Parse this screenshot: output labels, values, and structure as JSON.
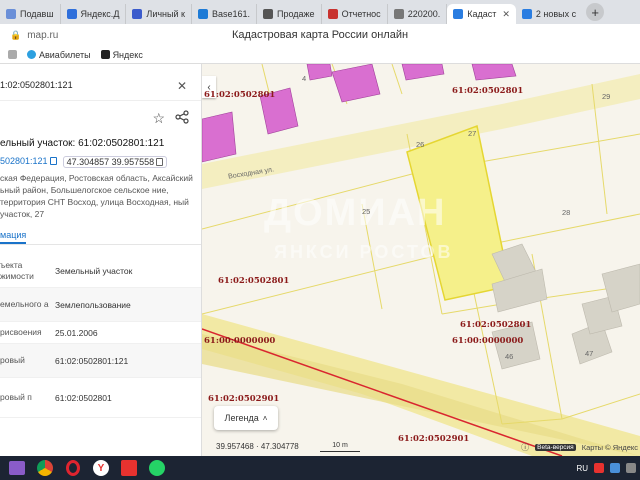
{
  "browser": {
    "tabs": [
      {
        "label": "Подавш",
        "color": "#6a8fd8"
      },
      {
        "label": "Яндекс.Д",
        "color": "#2f6fdb"
      },
      {
        "label": "Личный к",
        "color": "#3b5bcc"
      },
      {
        "label": "Base161.",
        "color": "#1e7bd6"
      },
      {
        "label": "Продаже",
        "color": "#555"
      },
      {
        "label": "Отчетнос",
        "color": "#c8322f"
      },
      {
        "label": "220200.",
        "color": "#777"
      },
      {
        "label": "Кадаст",
        "color": "#2a7de1",
        "active": true
      },
      {
        "label": "2 новых с",
        "color": "#2a7de1"
      }
    ],
    "new_tab": "+",
    "url": "map.ru",
    "page_title": "Кадастровая карта России онлайн",
    "bookmarks": [
      {
        "label": "",
        "color": "#aaa"
      },
      {
        "label": "Авиабилеты",
        "color": "#2da0e0"
      },
      {
        "label": "Яндекс",
        "color": "#222"
      }
    ]
  },
  "panel": {
    "header_number": "1:02:0502801:121",
    "parcel_title": "ельный участок: 61:02:0502801:121",
    "link_number": "502801:121",
    "coords": "47.304857 39.957558",
    "address": "ская Федерация, Ростовская область, Аксайский ьный район, Большелогское сельское ние, территория СНТ Восход, улица Восходная, ный участок, 27",
    "info_tab": "мация",
    "rows": [
      {
        "label": "ъекта жимости",
        "value": "Земельный участок"
      },
      {
        "label": "емельного а",
        "value": "Землепользование"
      },
      {
        "label": "рисвоения",
        "value": "25.01.2006"
      },
      {
        "label": "ровый",
        "value": "61:02:0502801:121"
      },
      {
        "label": "ровый п",
        "value": "61:02:0502801"
      }
    ]
  },
  "map": {
    "labels": [
      {
        "text": "61:02:0502801",
        "cls": "a"
      },
      {
        "text": "61:02:0502801",
        "cls": "b"
      },
      {
        "text": "61:02:0502801",
        "cls": "c"
      },
      {
        "text": "61:02:0502801",
        "cls": "d"
      },
      {
        "text": "61:00:0000000",
        "cls": "e"
      },
      {
        "text": "61:00:0000000",
        "cls": "f"
      },
      {
        "text": "61:02:0502901",
        "cls": "g"
      },
      {
        "text": "61:02:0502901",
        "cls": "h"
      }
    ],
    "numbers": [
      "4",
      "29",
      "26",
      "27",
      "25",
      "28",
      "46",
      "47"
    ],
    "street": "Восходная ул.",
    "watermark": "ДОМИАН",
    "watermark2": "ЯНКСИ РОСТОВ",
    "legend": "Легенда",
    "coords": "39.957468 · 47.304778",
    "scale": "10 m",
    "beta": "Beta-версия",
    "attribution": "Карты © Яндекс",
    "colors": {
      "parcel_selected": "#f5f08a",
      "building": "#d96fd0",
      "road": "#f2e9a4"
    }
  },
  "taskbar": {
    "lang": "RU"
  }
}
